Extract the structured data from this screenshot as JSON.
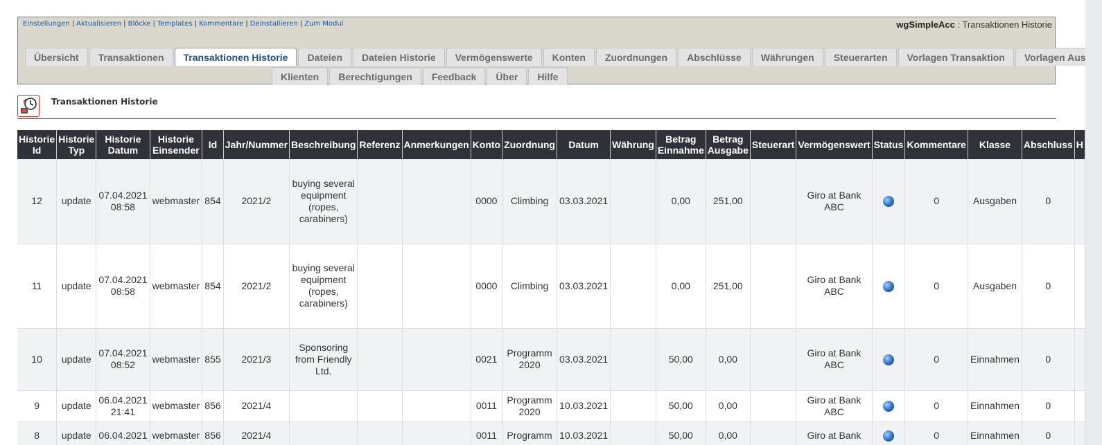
{
  "admin_links": [
    "Einstellungen",
    "Aktualisieren",
    "Blöcke",
    "Templates",
    "Kommentare",
    "Deinstallieren",
    "Zum Modul"
  ],
  "module": {
    "name": "wgSimpleAcc",
    "separator": " : ",
    "page": "Transaktionen Historie"
  },
  "tabs_row1": [
    "Übersicht",
    "Transaktionen",
    "Transaktionen Historie",
    "Dateien",
    "Dateien Historie",
    "Vermögenswerte",
    "Konten",
    "Zuordnungen",
    "Abschlüsse",
    "Währungen",
    "Steuerarten",
    "Vorlagen Transaktion",
    "Vorlagen Ausgabe"
  ],
  "tabs_row2": [
    "Klienten",
    "Berechtigungen",
    "Feedback",
    "Über",
    "Hilfe"
  ],
  "active_tab": "Transaktionen Historie",
  "section_title": "Transaktionen Historie",
  "section_icon": "history-clock-icon",
  "columns": [
    "Historie Id",
    "Historie Typ",
    "Historie Datum",
    "Historie Einsender",
    "Id",
    "Jahr/Nummer",
    "Beschreibung",
    "Referenz",
    "Anmerkungen",
    "Konto",
    "Zuordnung",
    "Datum",
    "Währung",
    "Betrag Einnahme",
    "Betrag Ausgabe",
    "Steuerart",
    "Vermögenswert",
    "Status",
    "Kommentare",
    "Klasse",
    "Abschluss",
    "H"
  ],
  "rows": [
    {
      "hist_id": "12",
      "hist_type": "update",
      "hist_date": "07.04.2021 08:58",
      "submitter": "webmaster",
      "id": "854",
      "year_num": "2021/2",
      "desc": "buying several equipment (ropes, carabiners)",
      "ref": "",
      "notes": "",
      "account": "0000",
      "allocation": "Climbing",
      "date": "03.03.2021",
      "currency": "",
      "income": "0,00",
      "expense": "251,00",
      "tax": "",
      "asset": "Giro at Bank ABC",
      "status_icon": "globe-icon",
      "comments": "0",
      "class": "Ausgaben",
      "closing": "0"
    },
    {
      "hist_id": "11",
      "hist_type": "update",
      "hist_date": "07.04.2021 08:58",
      "submitter": "webmaster",
      "id": "854",
      "year_num": "2021/2",
      "desc": "buying several equipment (ropes, carabiners)",
      "ref": "",
      "notes": "",
      "account": "0000",
      "allocation": "Climbing",
      "date": "03.03.2021",
      "currency": "",
      "income": "0,00",
      "expense": "251,00",
      "tax": "",
      "asset": "Giro at Bank ABC",
      "status_icon": "globe-icon",
      "comments": "0",
      "class": "Ausgaben",
      "closing": "0"
    },
    {
      "hist_id": "10",
      "hist_type": "update",
      "hist_date": "07.04.2021 08:52",
      "submitter": "webmaster",
      "id": "855",
      "year_num": "2021/3",
      "desc": "Sponsoring from Friendly Ltd.",
      "ref": "",
      "notes": "",
      "account": "0021",
      "allocation": "Programm 2020",
      "date": "03.03.2021",
      "currency": "",
      "income": "50,00",
      "expense": "0,00",
      "tax": "",
      "asset": "Giro at Bank ABC",
      "status_icon": "globe-icon",
      "comments": "0",
      "class": "Einnahmen",
      "closing": "0"
    },
    {
      "hist_id": "9",
      "hist_type": "update",
      "hist_date": "06.04.2021 21:41",
      "submitter": "webmaster",
      "id": "856",
      "year_num": "2021/4",
      "desc": "",
      "ref": "",
      "notes": "",
      "account": "0011",
      "allocation": "Programm 2020",
      "date": "10.03.2021",
      "currency": "",
      "income": "50,00",
      "expense": "0,00",
      "tax": "",
      "asset": "Giro at Bank ABC",
      "status_icon": "globe-icon",
      "comments": "0",
      "class": "Einnahmen",
      "closing": "0"
    },
    {
      "hist_id": "8",
      "hist_type": "update",
      "hist_date": "06.04.2021",
      "submitter": "webmaster",
      "id": "856",
      "year_num": "2021/4",
      "desc": "",
      "ref": "",
      "notes": "",
      "account": "0011",
      "allocation": "Programm",
      "date": "10.03.2021",
      "currency": "",
      "income": "50,00",
      "expense": "0,00",
      "tax": "",
      "asset": "Giro at Bank",
      "status_icon": "globe-icon",
      "comments": "0",
      "class": "Einnahmen",
      "closing": "0"
    }
  ]
}
